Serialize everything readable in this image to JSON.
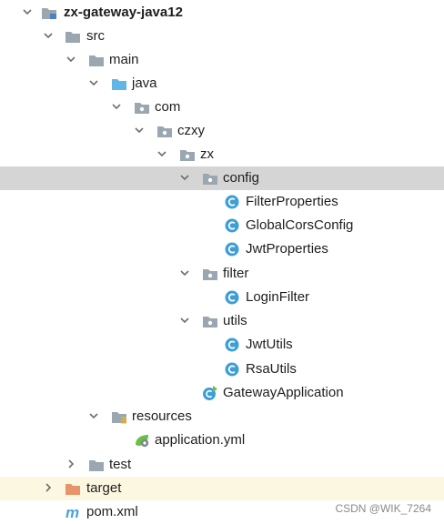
{
  "tree": {
    "root": {
      "label": "zx-gateway-java12",
      "icon": "module-folder-icon",
      "expanded": true
    },
    "src": {
      "label": "src",
      "icon": "folder-icon",
      "expanded": true
    },
    "main": {
      "label": "main",
      "icon": "folder-icon",
      "expanded": true
    },
    "java": {
      "label": "java",
      "icon": "source-root-folder-icon",
      "expanded": true
    },
    "com": {
      "label": "com",
      "icon": "package-icon",
      "expanded": true
    },
    "czxy": {
      "label": "czxy",
      "icon": "package-icon",
      "expanded": true
    },
    "zx": {
      "label": "zx",
      "icon": "package-icon",
      "expanded": true
    },
    "config": {
      "label": "config",
      "icon": "package-icon",
      "expanded": true,
      "selected": true
    },
    "filter_properties": {
      "label": "FilterProperties",
      "icon": "class-icon"
    },
    "global_cors_config": {
      "label": "GlobalCorsConfig",
      "icon": "class-icon"
    },
    "jwt_properties": {
      "label": "JwtProperties",
      "icon": "class-icon"
    },
    "filter": {
      "label": "filter",
      "icon": "package-icon",
      "expanded": true
    },
    "login_filter": {
      "label": "LoginFilter",
      "icon": "class-icon"
    },
    "utils": {
      "label": "utils",
      "icon": "package-icon",
      "expanded": true
    },
    "jwt_utils": {
      "label": "JwtUtils",
      "icon": "class-icon"
    },
    "rsa_utils": {
      "label": "RsaUtils",
      "icon": "class-icon"
    },
    "gateway_application": {
      "label": "GatewayApplication",
      "icon": "spring-boot-class-icon"
    },
    "resources": {
      "label": "resources",
      "icon": "resources-folder-icon",
      "expanded": true
    },
    "application_yml": {
      "label": "application.yml",
      "icon": "spring-yml-icon"
    },
    "test": {
      "label": "test",
      "icon": "folder-icon",
      "expanded": false
    },
    "target": {
      "label": "target",
      "icon": "excluded-folder-icon",
      "expanded": false
    },
    "pom_xml": {
      "label": "pom.xml",
      "icon": "maven-icon"
    }
  },
  "colors": {
    "selection": "#d5d5d5",
    "excluded_row": "#fbf7e0",
    "class_badge": "#3d9fd6",
    "folder_gray": "#9aa7b0",
    "source_folder": "#62b5e5",
    "excluded_folder": "#e8946a",
    "maven_m": "#4aa3df"
  },
  "watermark": "CSDN @WIK_7264"
}
